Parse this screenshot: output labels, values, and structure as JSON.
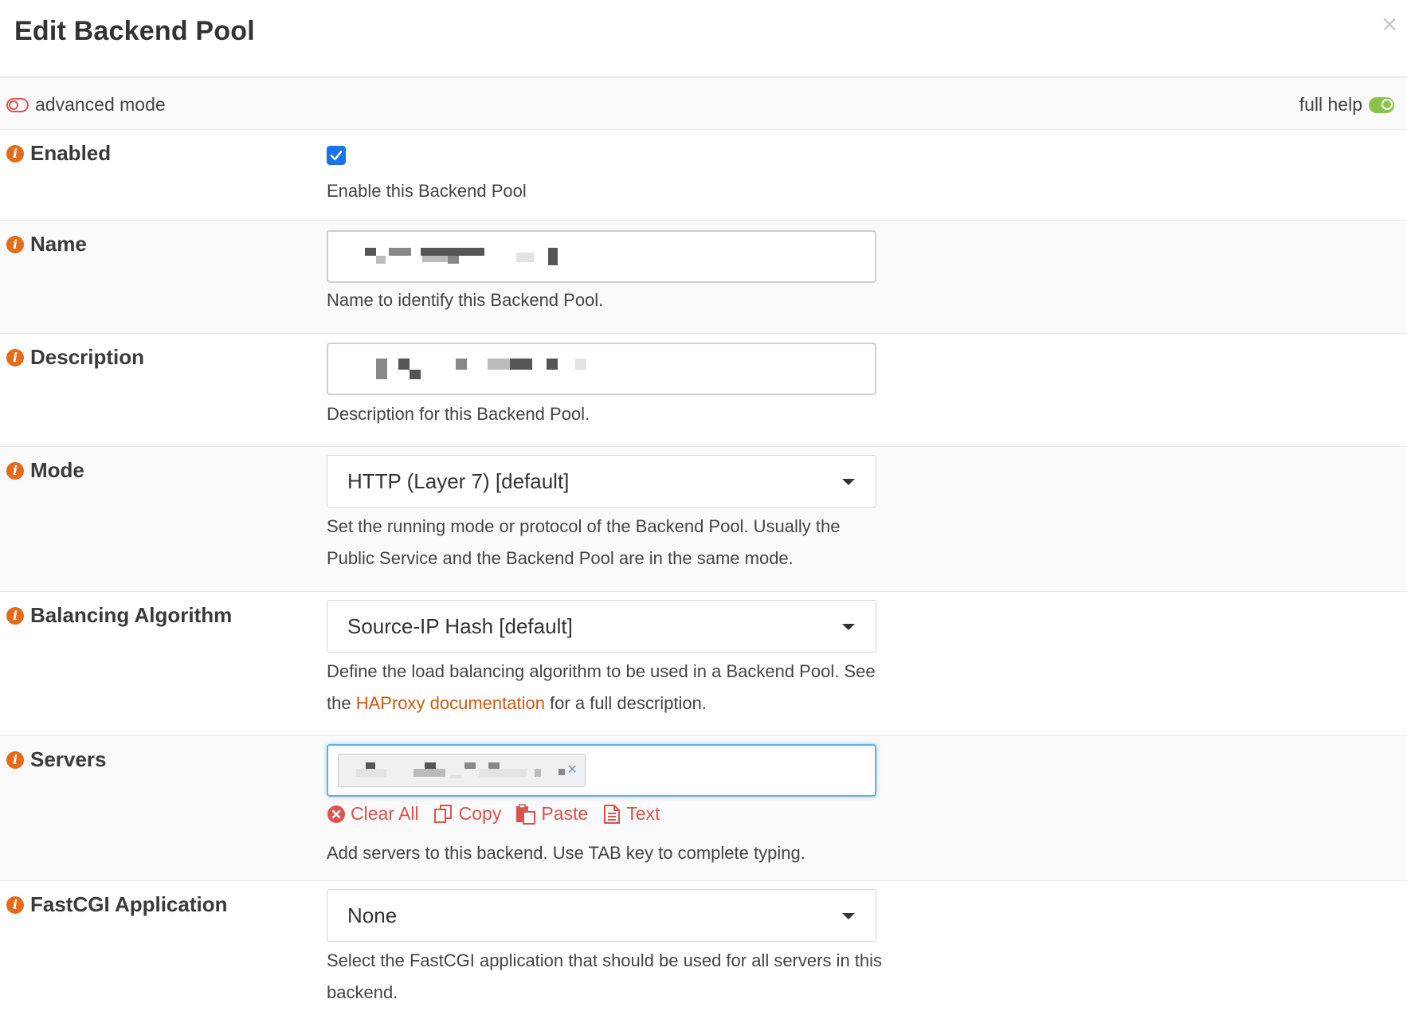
{
  "modal": {
    "title": "Edit Backend Pool",
    "close_glyph": "×"
  },
  "toolbar": {
    "advanced_mode_label": "advanced mode",
    "advanced_mode_on": false,
    "full_help_label": "full help",
    "full_help_on": true
  },
  "fields": {
    "enabled": {
      "label": "Enabled",
      "checked": true,
      "help": "Enable this Backend Pool"
    },
    "name": {
      "label": "Name",
      "help": "Name to identify this Backend Pool."
    },
    "description": {
      "label": "Description",
      "help": "Description for this Backend Pool."
    },
    "mode": {
      "label": "Mode",
      "selected": "HTTP (Layer 7) [default]",
      "help": "Set the running mode or protocol of the Backend Pool. Usually the Public Service and the Backend Pool are in the same mode."
    },
    "balancing_algorithm": {
      "label": "Balancing Algorithm",
      "selected": "Source-IP Hash [default]",
      "help_before": "Define the load balancing algorithm to be used in a Backend Pool. See the ",
      "help_link": "HAProxy documentation",
      "help_after": " for a full description."
    },
    "servers": {
      "label": "Servers",
      "tag_remove": "×",
      "actions": {
        "clear_all": "Clear All",
        "copy": "Copy",
        "paste": "Paste",
        "text": "Text"
      },
      "help": "Add servers to this backend. Use TAB key to complete typing."
    },
    "fastcgi": {
      "label": "FastCGI Application",
      "selected": "None",
      "help": "Select the FastCGI application that should be used for all servers in this backend."
    }
  },
  "icons": {
    "info": "info-icon",
    "clear_all": "times-circle-icon",
    "copy": "copy-icon",
    "paste": "paste-icon",
    "text": "file-text-icon"
  },
  "colors": {
    "accent_orange": "#e36b1a",
    "danger_red": "#d9534f",
    "toggle_green": "#8bc34a",
    "checkbox_blue": "#1a73e8",
    "focus_blue": "#66afe9"
  }
}
